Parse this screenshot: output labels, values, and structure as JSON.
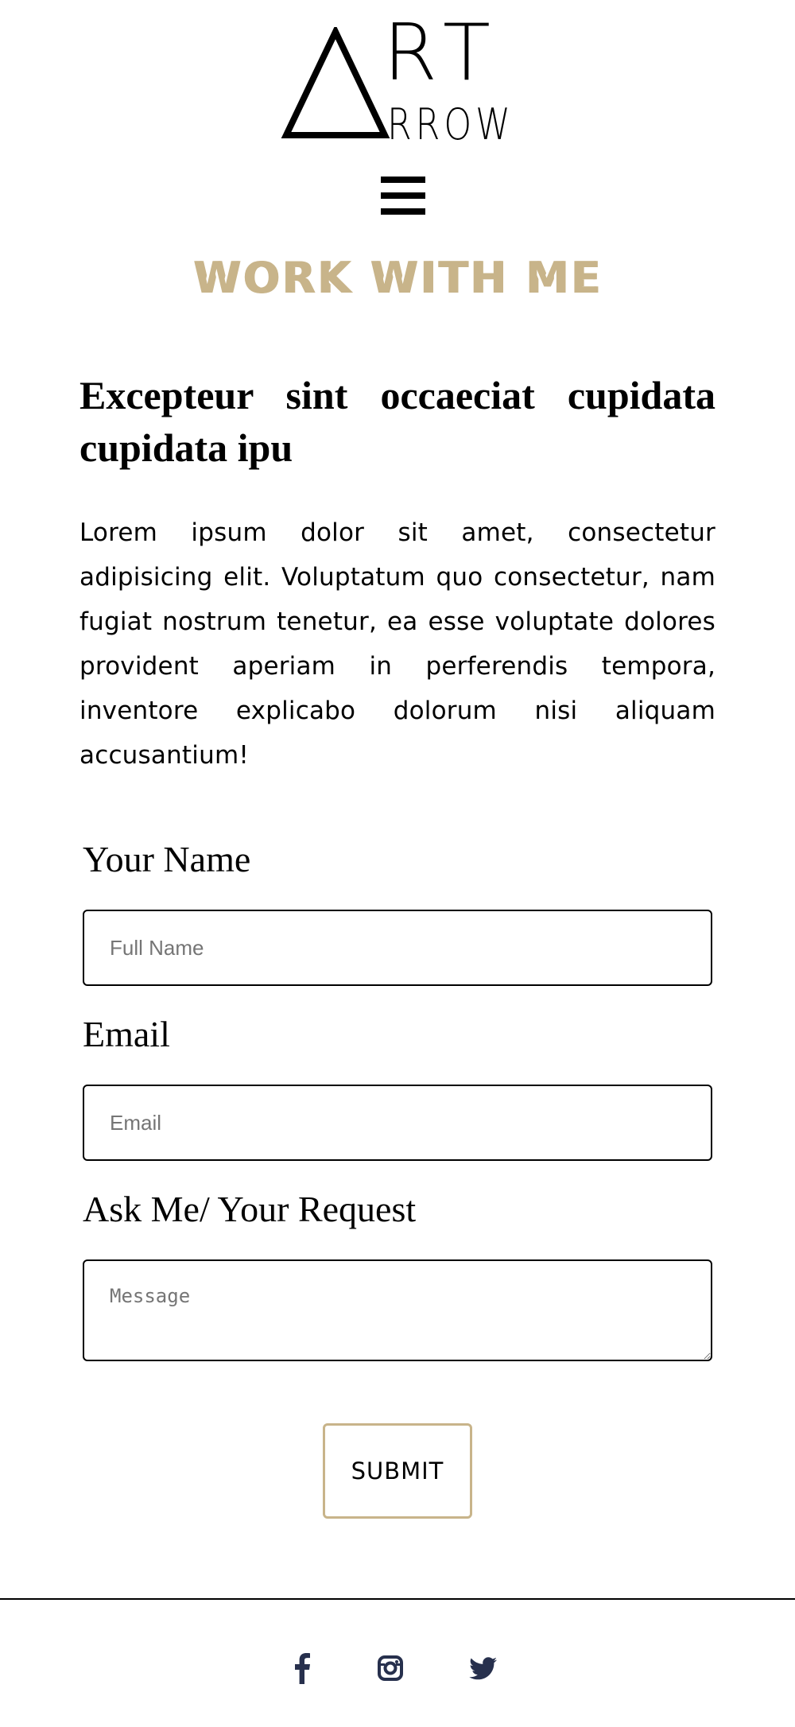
{
  "brand": {
    "logo_main": "RT",
    "logo_sub": "RROW"
  },
  "nav": {
    "menu_icon": "hamburger-menu-icon"
  },
  "page": {
    "title": "WORK WITH ME",
    "headline": "Excepteur sint occaeciat cupidata cupidata ipu",
    "intro": "Lorem ipsum dolor sit amet, consectetur adipisicing elit. Voluptatum quo consectetur, nam fugiat nostrum tenetur, ea esse voluptate dolores provident aperiam in perferendis tempora, inventore explicabo dolorum nisi aliquam accusantium!"
  },
  "form": {
    "name_label": "Your Name",
    "name_placeholder": "Full Name",
    "name_value": "",
    "email_label": "Email",
    "email_placeholder": "Email",
    "email_value": "",
    "request_label": "Ask Me/ Your Request",
    "message_placeholder": "Message",
    "message_value": "",
    "submit_label": "SUBMIT"
  },
  "footer": {
    "social": [
      {
        "icon": "facebook-icon"
      },
      {
        "icon": "instagram-icon"
      },
      {
        "icon": "twitter-icon"
      }
    ]
  },
  "colors": {
    "accent": "#c8b48a",
    "social_icon": "#27304d",
    "text": "#000000",
    "background": "#ffffff"
  }
}
